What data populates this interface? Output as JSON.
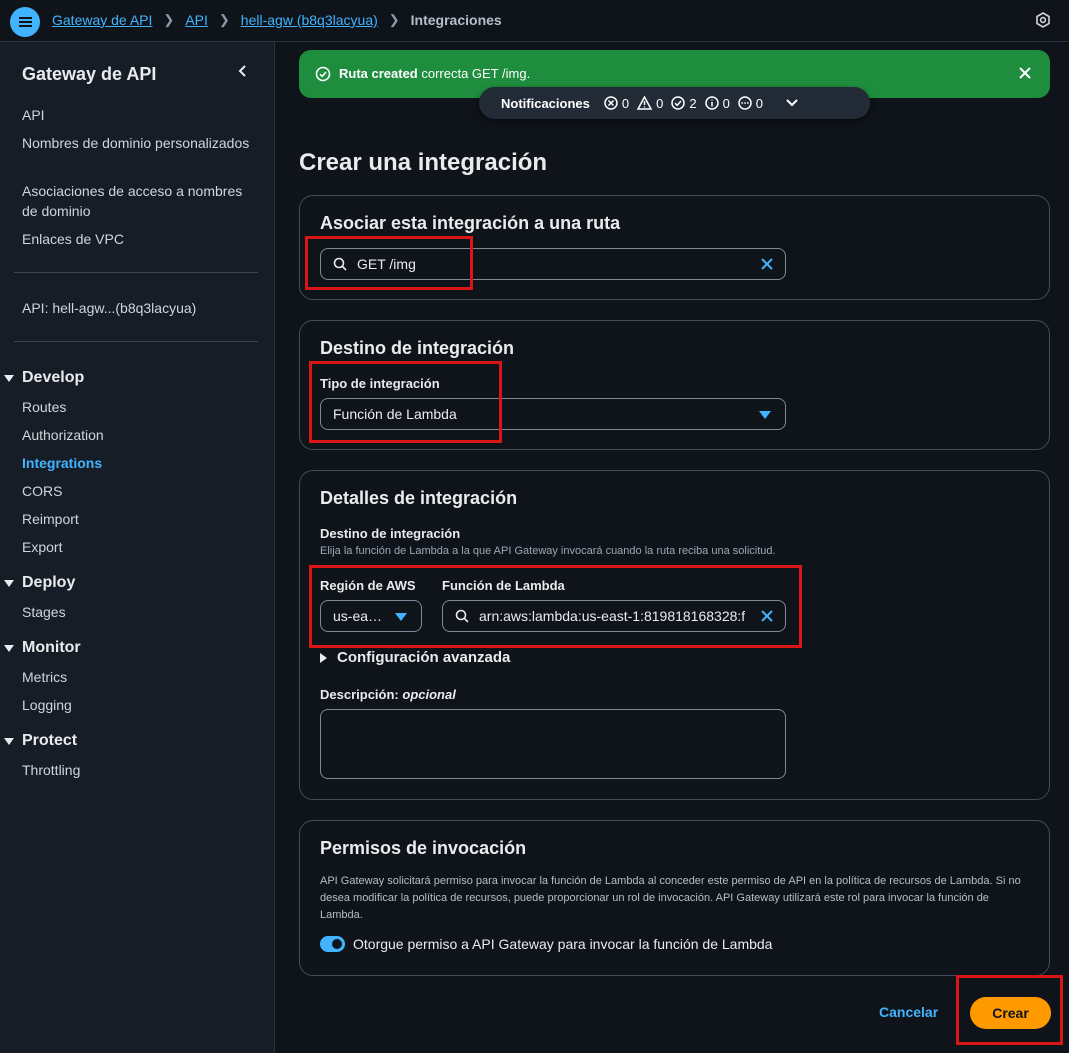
{
  "topbar": {
    "breadcrumbs": [
      "Gateway de API",
      "API",
      "hell-agw (b8q3lacyua)",
      "Integraciones"
    ]
  },
  "sidebar": {
    "title": "Gateway de API",
    "links": [
      "API",
      "Nombres de dominio personalizados",
      "Asociaciones de acceso a nombres de dominio",
      "Enlaces de VPC"
    ],
    "api_name": "API: hell-agw...(b8q3lacyua)",
    "sections": {
      "develop": {
        "label": "Develop",
        "items": [
          "Routes",
          "Authorization",
          "Integrations",
          "CORS",
          "Reimport",
          "Export"
        ]
      },
      "deploy": {
        "label": "Deploy",
        "items": [
          "Stages"
        ]
      },
      "monitor": {
        "label": "Monitor",
        "items": [
          "Metrics",
          "Logging"
        ]
      },
      "protect": {
        "label": "Protect",
        "items": [
          "Throttling"
        ]
      }
    },
    "active_item": "Integrations"
  },
  "notification": {
    "bold": "Ruta created",
    "text": " correcta GET /img."
  },
  "notif_bar": {
    "label": "Notificaciones",
    "errors": "0",
    "warnings": "0",
    "success": "2",
    "info": "0",
    "in_progress": "0"
  },
  "page": {
    "title": "Crear una integración"
  },
  "route_card": {
    "heading": "Asociar esta integración a una ruta",
    "route_value": "GET /img"
  },
  "target_card": {
    "heading": "Destino de integración",
    "type_label": "Tipo de integración",
    "type_value": "Función de Lambda"
  },
  "details_card": {
    "heading": "Detalles de integración",
    "target_label": "Destino de integración",
    "target_desc": "Elija la función de Lambda a la que API Gateway invocará cuando la ruta reciba una solicitud.",
    "region_label": "Región de AWS",
    "region_value": "us-ea…",
    "lambda_label": "Función de Lambda",
    "lambda_value": "arn:aws:lambda:us-east-1:819818168328:f",
    "advanced_label": "Configuración avanzada",
    "desc_label": "Descripción:",
    "desc_optional": "opcional"
  },
  "perm_card": {
    "heading": "Permisos de invocación",
    "desc": "API Gateway solicitará permiso para invocar la función de Lambda al conceder este permiso de API en la política de recursos de Lambda. Si no desea modificar la política de recursos, puede proporcionar un rol de invocación. API Gateway utilizará este rol para invocar la función de Lambda.",
    "toggle_label": "Otorgue permiso a API Gateway para invocar la función de Lambda",
    "toggle_on": true
  },
  "actions": {
    "cancel": "Cancelar",
    "create": "Crear"
  },
  "colors": {
    "accent": "#42b4ff",
    "success": "#1e8e3e",
    "primary_button": "#ff9900",
    "highlight_box": "#d91515"
  }
}
